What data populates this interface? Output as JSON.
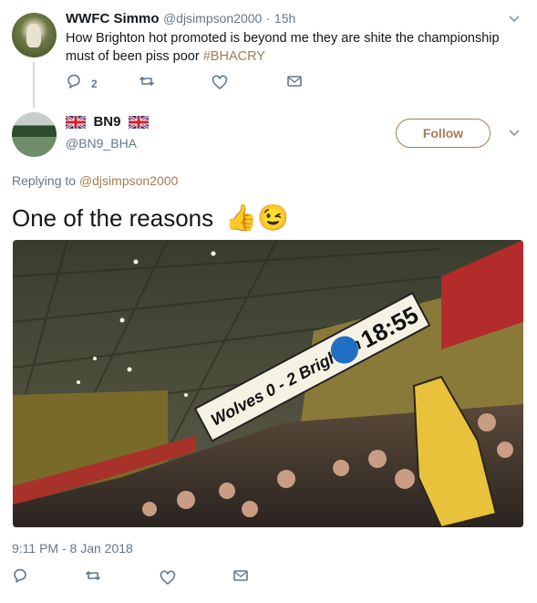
{
  "parent_tweet": {
    "author_name": "WWFC Simmo",
    "handle": "@djsimpson2000",
    "separator": "·",
    "time": "15h",
    "text_main": "How Brighton hot promoted is beyond me they are shite the championship must of been piss poor ",
    "hashtag": "#BHACRY",
    "reply_count": "2"
  },
  "main_tweet": {
    "author_name": "BN9",
    "handle": "@BN9_BHA",
    "follow_label": "Follow",
    "replying_prefix": "Replying to ",
    "replying_handle": "@djsimpson2000",
    "text": "One of the reasons",
    "emoji": [
      "👍",
      "😉"
    ],
    "scoreboard_text": "Wolves 0 - 2 Brighton",
    "clock_text": "18:55",
    "timestamp": "9:11 PM - 8 Jan 2018"
  },
  "colors": {
    "accent": "#a67c52",
    "muted": "#657786",
    "text": "#14171a"
  }
}
